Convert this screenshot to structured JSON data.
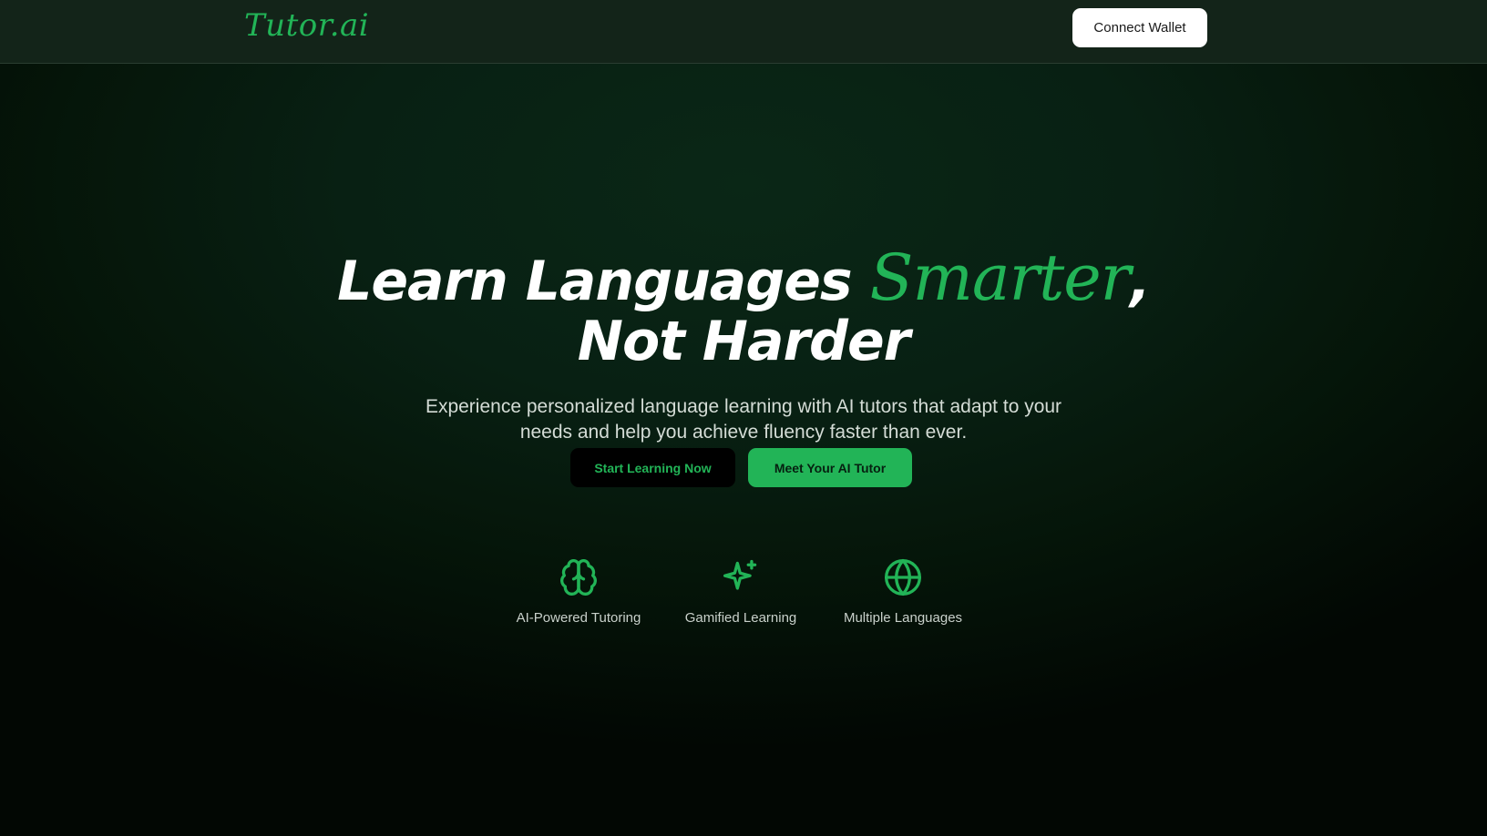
{
  "header": {
    "logo": "Tutor.ai",
    "connect_wallet": "Connect Wallet"
  },
  "hero": {
    "title_part1": "Learn Languages ",
    "title_accent": "Smarter",
    "title_comma": ",",
    "title_line2": "Not Harder",
    "subtitle": "Experience personalized language learning with AI tutors that adapt to your needs and help you achieve fluency faster than ever.",
    "primary_button": "Start Learning Now",
    "secondary_button": "Meet Your AI Tutor"
  },
  "features": [
    {
      "icon": "brain-icon",
      "label": "AI-Powered Tutoring"
    },
    {
      "icon": "sparkles-icon",
      "label": "Gamified Learning"
    },
    {
      "icon": "globe-icon",
      "label": "Multiple Languages"
    }
  ],
  "colors": {
    "accent": "#22b457",
    "background": "#061a0e",
    "navbar": "#132419",
    "text": "#ffffff"
  }
}
